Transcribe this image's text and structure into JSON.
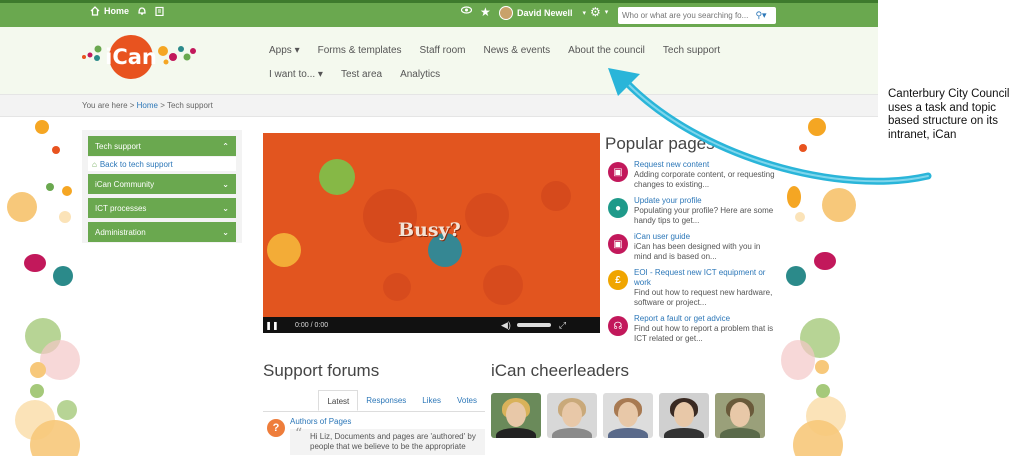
{
  "topbar": {
    "home_label": "Home",
    "user_name": "David Newell",
    "search_placeholder": "Who or what are you searching fo..."
  },
  "nav": {
    "row1": [
      "Apps ▾",
      "Forms & templates",
      "Staff room",
      "News & events",
      "About the council",
      "Tech support"
    ],
    "row2": [
      "I want to... ▾",
      "Test area",
      "Analytics"
    ]
  },
  "breadcrumb": {
    "prefix": "You are here >",
    "home": "Home",
    "separator": ">",
    "current": "Tech support"
  },
  "sidenav": {
    "top_item": "Tech support",
    "back_link": "Back to tech support",
    "items": [
      "iCan Community",
      "ICT processes",
      "Administration"
    ]
  },
  "video": {
    "title": "Busy?",
    "time_current": "0:00",
    "time_separator": "/",
    "time_total": "0:00"
  },
  "popular": {
    "heading": "Popular pages",
    "items": [
      {
        "title": "Request new content",
        "desc": "Adding corporate content, or requesting changes to existing...",
        "icon": "monitor-icon",
        "color": "#c2185b"
      },
      {
        "title": "Update your profile",
        "desc": "Populating your profile? Here are some handy tips to get...",
        "icon": "person-icon",
        "color": "#1f9a8a"
      },
      {
        "title": "iCan user guide",
        "desc": "iCan has been designed with you in mind and is based on...",
        "icon": "monitor-icon",
        "color": "#c2185b"
      },
      {
        "title": "EOI - Request new ICT equipment or work",
        "desc": "Find out how to request new hardware, software or project...",
        "icon": "pound-icon",
        "color": "#f0a500"
      },
      {
        "title": "Report a fault or get advice",
        "desc": "Find out how to report a problem that is ICT related or get...",
        "icon": "headset-icon",
        "color": "#c2185b"
      }
    ]
  },
  "forums": {
    "heading": "Support forums",
    "tabs": [
      "Latest",
      "Responses",
      "Likes",
      "Votes"
    ],
    "post_title": "Authors of Pages",
    "post_text": "Hi Liz, Documents and pages are 'authored' by people that we believe to be the appropriate"
  },
  "cheerleaders": {
    "heading": "iCan cheerleaders"
  },
  "annotation": {
    "caption": "Canterbury City Council uses a task and topic based structure on its intranet, iCan"
  },
  "colors": {
    "brand_green": "#6aa84f",
    "link_blue": "#2c77b8",
    "arrow_blue": "#2ab5d9",
    "logo_orange": "#e8531f"
  }
}
